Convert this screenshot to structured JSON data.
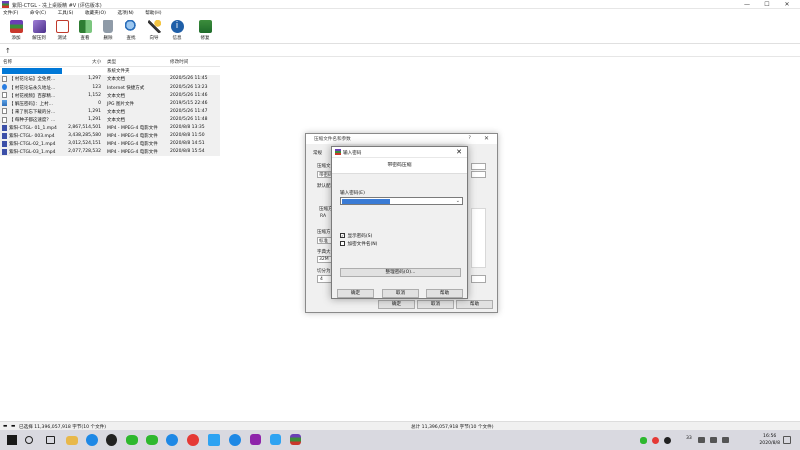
{
  "window": {
    "title": "紫阳-CTGL - 冼上桌版精 #V (评估版本)",
    "minimize": "—",
    "maximize": "☐",
    "close": "✕"
  },
  "menu": [
    "文件(F)",
    "命令(C)",
    "工具(S)",
    "收藏夹(O)",
    "选项(N)",
    "帮助(H)"
  ],
  "toolbar": [
    {
      "label": "添加",
      "icon": "add-archive-icon",
      "color": "#c0392b"
    },
    {
      "label": "解压到",
      "icon": "extract-icon",
      "color": "#7d5fb5"
    },
    {
      "label": "测试",
      "icon": "test-icon",
      "color": "#e07a2e"
    },
    {
      "label": "查看",
      "icon": "view-icon",
      "color": "#2e7d32"
    },
    {
      "label": "删除",
      "icon": "delete-icon",
      "color": "#5d6d7e"
    },
    {
      "label": "查找",
      "icon": "find-icon",
      "color": "#2c6fbb"
    },
    {
      "label": "向导",
      "icon": "wizard-icon",
      "color": "#8e44ad"
    },
    {
      "label": "信息",
      "icon": "info-icon",
      "color": "#1f5fa8"
    },
    {
      "label": "修复",
      "icon": "repair-icon",
      "color": "#2e8b3c"
    }
  ],
  "pathbar": {
    "up": "↑"
  },
  "filelist": {
    "columns": {
      "name": "名称",
      "size": "大小",
      "type": "类型",
      "modified": "修改时间"
    },
    "rows": [
      {
        "name": "",
        "size": "",
        "type": "系统文件夹",
        "modified": ""
      },
      {
        "name": "【 村花论坛】全免费...",
        "size": "1,297",
        "type": "文本文档",
        "modified": "2020/5/26 11:45"
      },
      {
        "name": "【 村花论坛永久地址...",
        "size": "123",
        "type": "Internet 快捷方式",
        "modified": "2020/5/26 13:23"
      },
      {
        "name": "【 村花视频】百部精...",
        "size": "1,152",
        "type": "文本文档",
        "modified": "2020/5/26 11:46"
      },
      {
        "name": "【 解压密码】：上村...",
        "size": "0",
        "type": "JPG 图片文件",
        "modified": "2019/5/15 22:46"
      },
      {
        "name": "【 来了别忘下载的分...",
        "size": "1,291",
        "type": "文本文档",
        "modified": "2020/5/26 11:47"
      },
      {
        "name": "【 每种子都这速度？...",
        "size": "1,291",
        "type": "文本文档",
        "modified": "2020/5/26 11:48"
      },
      {
        "name": "紫阳-CTGL- 01_1.mp4",
        "size": "2,867,514,501",
        "type": "MP4 - MPEG-4 电影文件",
        "modified": "2020/8/8 13:35"
      },
      {
        "name": "紫阳-CTGL- 003.mp4",
        "size": "3,438,285,580",
        "type": "MP4 - MPEG-4 电影文件",
        "modified": "2020/8/8 11:50"
      },
      {
        "name": "紫阳-CTGL-02_1.mp4",
        "size": "3,012,524,151",
        "type": "MP4 - MPEG-4 电影文件",
        "modified": "2020/8/8 14:51"
      },
      {
        "name": "紫阳-CTGL-03_1.mp4",
        "size": "2,077,728,532",
        "type": "MP4 - MPEG-4 电影文件",
        "modified": "2020/8/8 15:54"
      }
    ]
  },
  "status": {
    "left": "已选择 11,396,057,918 字节(10 个文件)",
    "right": "总计 11,396,057,918 字节(10 个文件)"
  },
  "dialog_params": {
    "title": "压缩文件名和参数",
    "help_q": "?",
    "close": "✕",
    "tab_general": "常规",
    "fragments": [
      "压缩文",
      "带密码",
      "默认配",
      "压缩方",
      "标准",
      "字典大",
      "32M",
      "切分为",
      "4",
      "压缩方",
      "RA"
    ],
    "ok": "确定",
    "cancel": "取消",
    "help": "帮助"
  },
  "dialog_password": {
    "title": "输入密码",
    "close": "✕",
    "subtitle": "带密码压缩",
    "label": "输入密码(E)",
    "value": "",
    "show_password": "显示密码(S)",
    "encrypt_names": "加密文件名(N)",
    "organize": "整理密码(O)...",
    "ok": "确定",
    "cancel": "取消",
    "help": "帮助"
  },
  "taskbar": {
    "time": "16:56",
    "date": "2020/8/8",
    "tray_text": "33"
  }
}
